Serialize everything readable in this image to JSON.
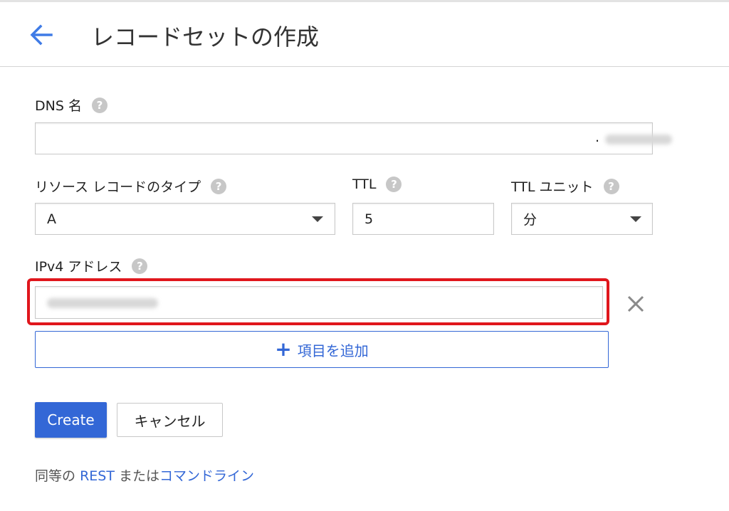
{
  "header": {
    "title": "レコードセットの作成",
    "back_icon": "arrow-left-icon"
  },
  "form": {
    "dns_name": {
      "label": "DNS 名",
      "value_suffix": "."
    },
    "record_type": {
      "label": "リソース レコードのタイプ",
      "value": "A"
    },
    "ttl": {
      "label": "TTL",
      "value": "5"
    },
    "ttl_unit": {
      "label": "TTL ユニット",
      "value": "分"
    },
    "ipv4": {
      "label": "IPv4 アドレス"
    },
    "add_item_label": "項目を追加",
    "help_icon": "?"
  },
  "actions": {
    "create_label": "Create",
    "cancel_label": "キャンセル"
  },
  "footer": {
    "prefix": "同等の",
    "rest_link": "REST",
    "middle": "または",
    "cli_link": "コマンドライン"
  },
  "colors": {
    "accent": "#3367d6",
    "highlight": "#e0161c"
  }
}
